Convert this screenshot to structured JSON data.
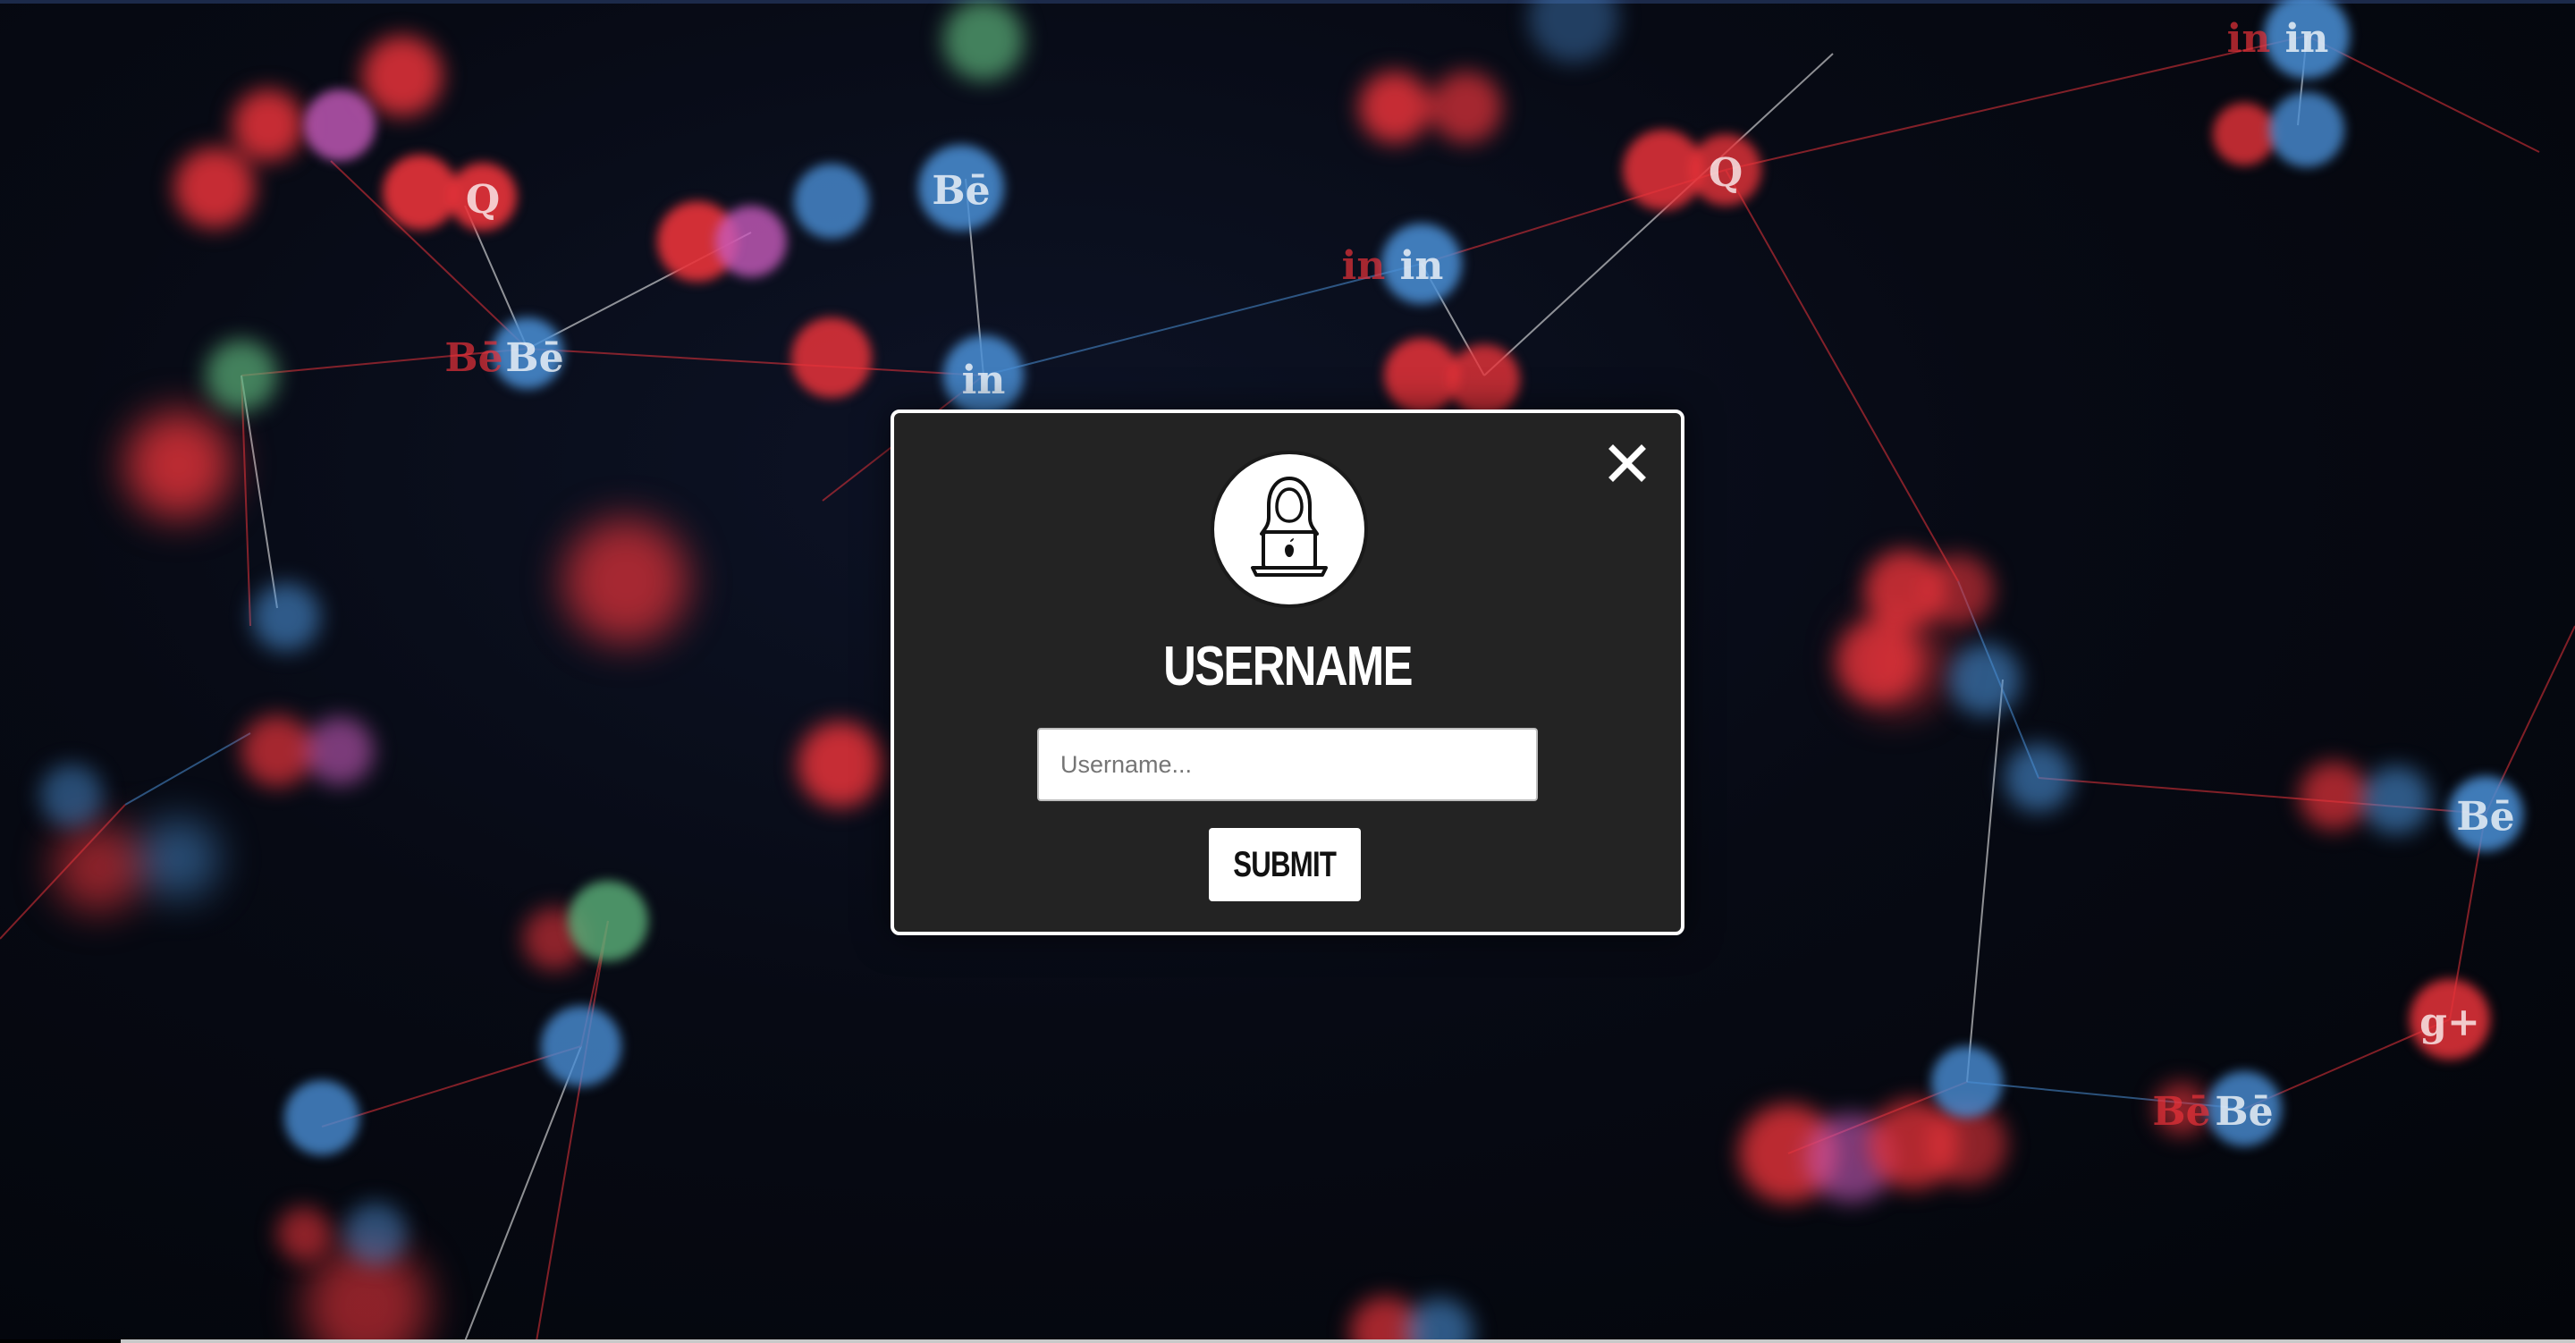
{
  "modal": {
    "title": "USERNAME",
    "input_placeholder": "Username...",
    "input_value": "",
    "submit_label": "SUBMIT",
    "close_icon": "close-icon",
    "avatar_icon": "hooded-hacker-laptop-icon"
  },
  "background": {
    "description_icons": [
      "linkedin-icon",
      "behance-icon",
      "twitter-icon",
      "vine-icon",
      "google-plus-icon",
      "flickr-icon",
      "quora-icon",
      "facebook-icon"
    ],
    "accent_red": "#e8333a",
    "accent_blue": "#4a8fd6",
    "base_color": "#050810"
  }
}
